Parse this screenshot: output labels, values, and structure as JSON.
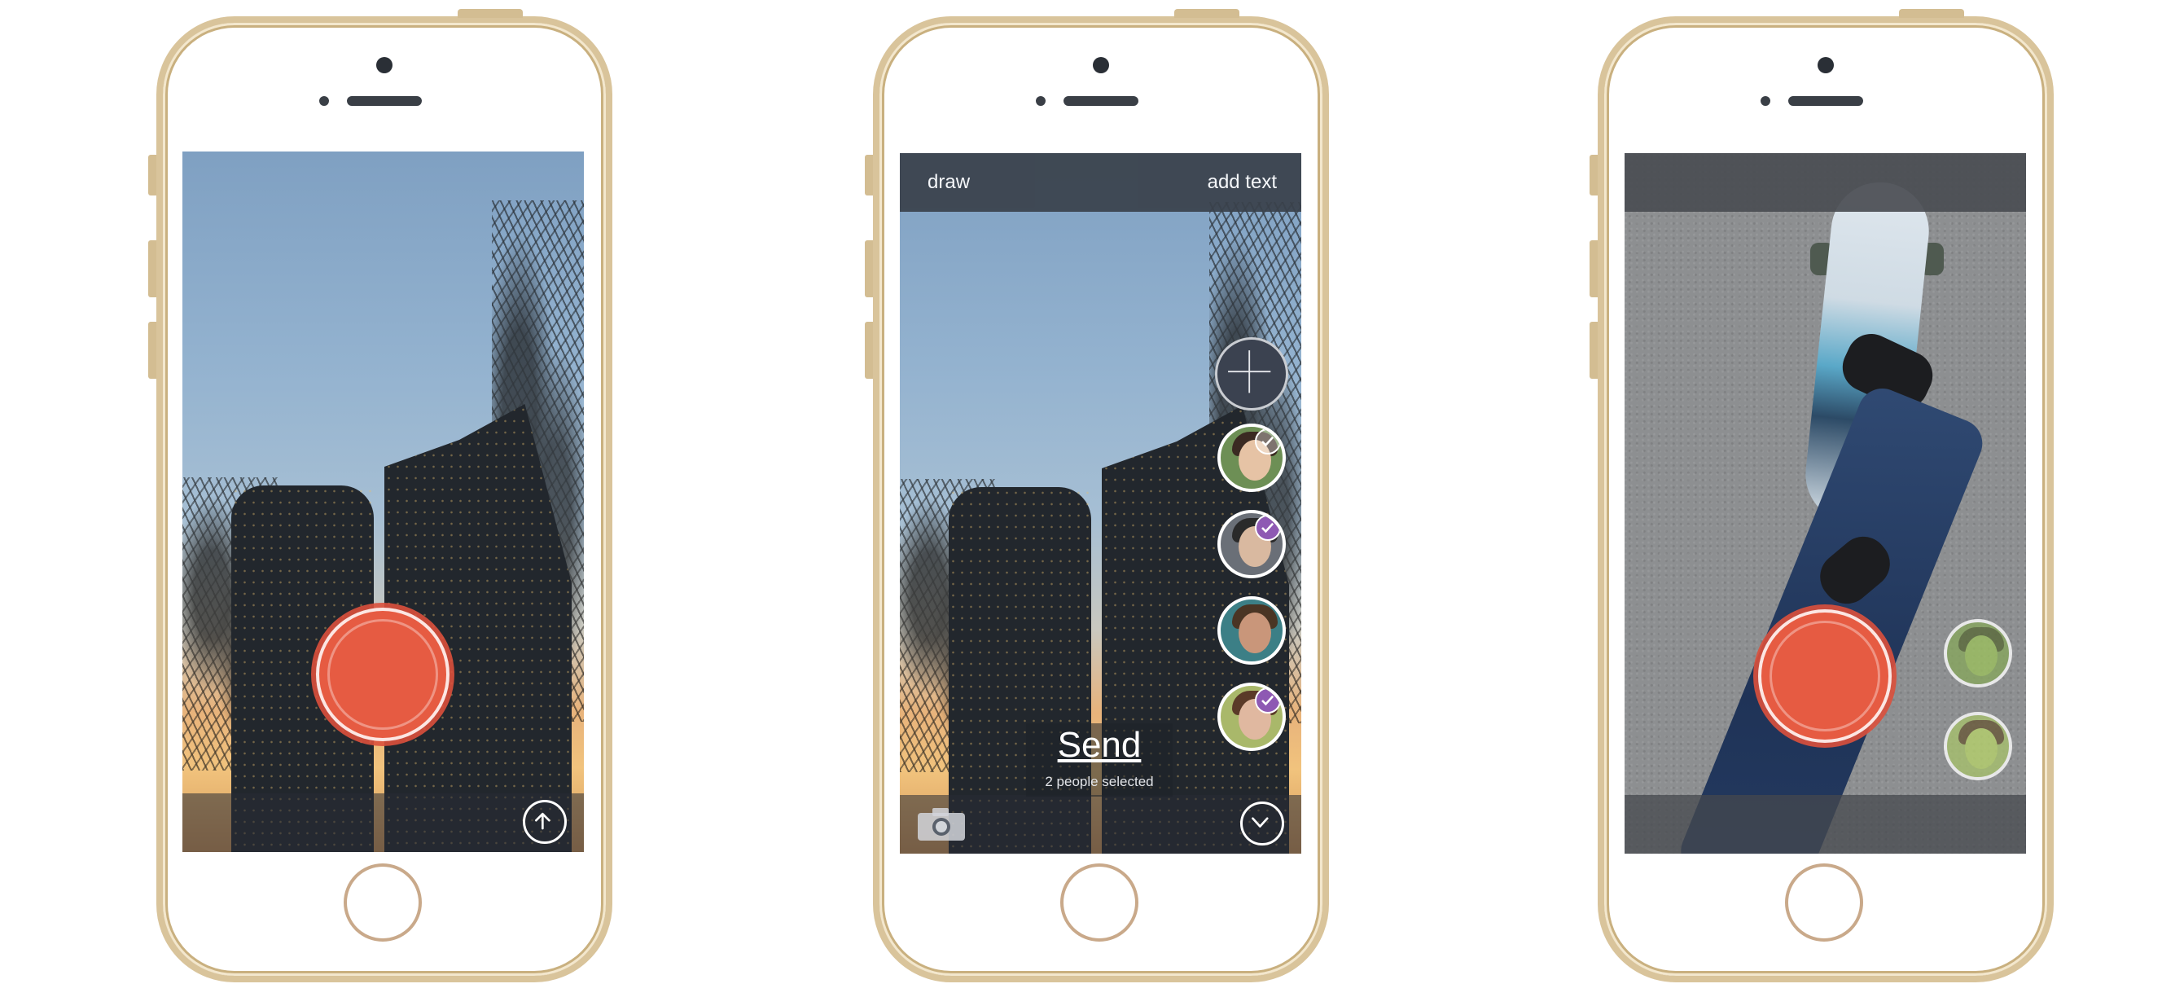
{
  "phone1": {
    "upload_icon": "arrow-up-circle-icon",
    "record_icon": "record-icon"
  },
  "phone2": {
    "top_bar": {
      "left_label": "draw",
      "right_label": "add text"
    },
    "add_icon": "plus-icon",
    "send_label": "Send",
    "selection_status": "2 people selected",
    "contacts": [
      {
        "avatar_color": "#6d8f55",
        "selected": false
      },
      {
        "avatar_color": "#6a6f77",
        "selected": true
      },
      {
        "avatar_color": "#3c7f86",
        "selected": false
      },
      {
        "avatar_color": "#a9b86a",
        "selected": true
      }
    ],
    "camera_icon": "camera-icon",
    "collapse_icon": "chevron-down-circle-icon"
  },
  "phone3": {
    "record_icon": "record-icon",
    "contacts": [
      {
        "avatar_color": "#87a65e"
      },
      {
        "avatar_color": "#a7c06e"
      }
    ]
  },
  "colors": {
    "record": "#e65b42",
    "selected_badge": "#8e59b3",
    "phone_gold": "#d9c49b"
  }
}
